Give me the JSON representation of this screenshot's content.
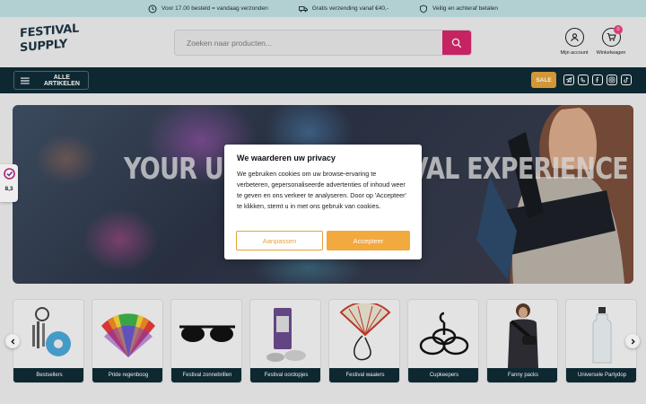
{
  "topbar": {
    "usps": [
      {
        "icon": "clock-icon",
        "text": "Voor 17.00 besteld = vandaag verzonden"
      },
      {
        "icon": "truck-icon",
        "text": "Gratis verzending vanaf €40,-"
      },
      {
        "icon": "shield-icon",
        "text": "Veilig en achteraf betalen"
      }
    ]
  },
  "header": {
    "logo_line1": "FESTIVAL",
    "logo_line2": "SUPPLY",
    "search_placeholder": "Zoeken naar producten...",
    "account_label": "Mijn account",
    "cart_label": "Winkelwagen",
    "cart_count": "0"
  },
  "nav": {
    "all_label": "ALLE ARTIKELEN",
    "sale_label": "SALE",
    "socials": [
      "telegram-icon",
      "whatsapp-icon",
      "facebook-icon",
      "instagram-icon",
      "tiktok-icon"
    ]
  },
  "hero": {
    "title": "YOUR ULTIMATE FESTIVAL EXPERIENCE"
  },
  "rating": {
    "value": "8,3"
  },
  "privacy_modal": {
    "title": "We waarderen uw privacy",
    "body": "We gebruiken cookies om uw browse-ervaring te verbeteren, gepersonaliseerde advertenties of inhoud weer te geven en ons verkeer te analyseren. Door op 'Accepteer' te klikken, stemt u in met ons gebruik van cookies.",
    "customize_label": "Aanpassen",
    "accept_label": "Accepteer"
  },
  "categories": [
    {
      "label": "Bestsellers",
      "icon": "keychain-icon"
    },
    {
      "label": "Pride regenboog",
      "icon": "rainbow-fan-icon"
    },
    {
      "label": "Festival zonnebrillen",
      "icon": "sunglasses-icon"
    },
    {
      "label": "Festival oordopjes",
      "icon": "earplugs-icon"
    },
    {
      "label": "Festival waaiers",
      "icon": "hand-fan-icon"
    },
    {
      "label": "Cupkeepers",
      "icon": "cup-holder-icon"
    },
    {
      "label": "Fanny packs",
      "icon": "fanny-pack-icon"
    },
    {
      "label": "Universele Partydop",
      "icon": "bottle-icon"
    }
  ],
  "colors": {
    "topbar": "#bfdfe0",
    "nav": "#0f2a35",
    "search_button": "#d4256a",
    "sale": "#e1a23a",
    "accept": "#f2a93e"
  }
}
